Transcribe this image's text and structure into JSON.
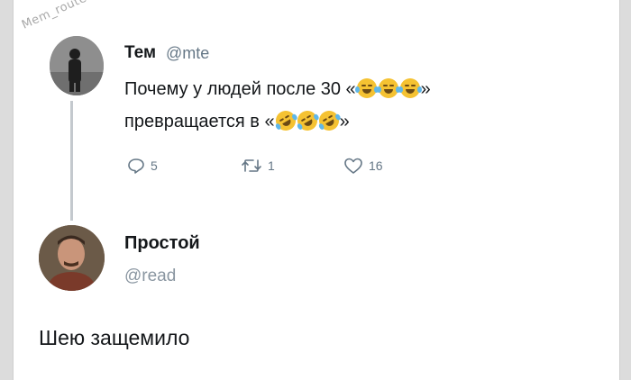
{
  "watermark": "Mem_router",
  "tweet": {
    "author_name": "Тем",
    "author_handle": "@mte",
    "text_line1": "Почему у людей после 30 «",
    "text_line1_end": "»",
    "text_line2": "превращается в «",
    "text_line2_end": "»",
    "emoji_line1": [
      "face-with-tears-of-joy",
      "face-with-tears-of-joy",
      "face-with-tears-of-joy"
    ],
    "emoji_line2": [
      "rolling-on-the-floor-laughing",
      "rolling-on-the-floor-laughing",
      "rolling-on-the-floor-laughing"
    ],
    "actions": {
      "replies": "5",
      "retweets": "1",
      "likes": "16"
    }
  },
  "reply": {
    "author_name": "Простой",
    "author_handle": "@read",
    "text": "Шею защемило"
  },
  "colors": {
    "secondary_text": "#657786",
    "thread_line": "#c4c9ce",
    "emoji_yellow": "#f5c232"
  }
}
